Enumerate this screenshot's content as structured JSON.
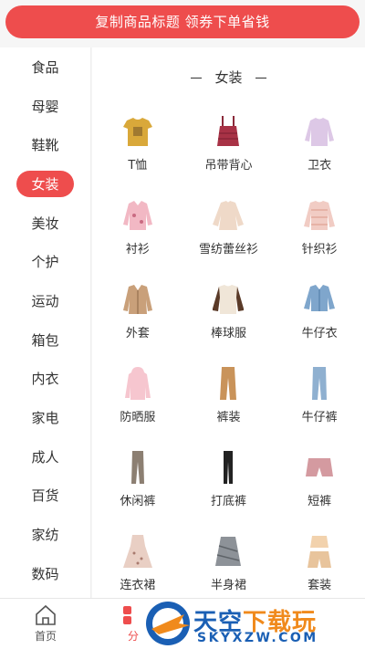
{
  "search": {
    "label": "复制商品标题 领券下单省钱"
  },
  "sidebar": {
    "items": [
      {
        "label": "食品"
      },
      {
        "label": "母婴"
      },
      {
        "label": "鞋靴"
      },
      {
        "label": "女装",
        "active": true
      },
      {
        "label": "美妆"
      },
      {
        "label": "个护"
      },
      {
        "label": "运动"
      },
      {
        "label": "箱包"
      },
      {
        "label": "内衣"
      },
      {
        "label": "家电"
      },
      {
        "label": "成人"
      },
      {
        "label": "百货"
      },
      {
        "label": "家纺"
      },
      {
        "label": "数码"
      }
    ]
  },
  "section": {
    "title": "女装"
  },
  "grid": {
    "items": [
      {
        "label": "T恤",
        "icon": "tshirt-icon"
      },
      {
        "label": "吊带背心",
        "icon": "camisole-icon"
      },
      {
        "label": "卫衣",
        "icon": "sweatshirt-icon"
      },
      {
        "label": "衬衫",
        "icon": "shirt-icon"
      },
      {
        "label": "雪纺蕾丝衫",
        "icon": "chiffon-blouse-icon"
      },
      {
        "label": "针织衫",
        "icon": "knit-sweater-icon"
      },
      {
        "label": "外套",
        "icon": "coat-icon"
      },
      {
        "label": "棒球服",
        "icon": "baseball-jacket-icon"
      },
      {
        "label": "牛仔衣",
        "icon": "denim-jacket-icon"
      },
      {
        "label": "防晒服",
        "icon": "sun-protection-jacket-icon"
      },
      {
        "label": "裤装",
        "icon": "trousers-icon"
      },
      {
        "label": "牛仔裤",
        "icon": "jeans-icon"
      },
      {
        "label": "休闲裤",
        "icon": "casual-pants-icon"
      },
      {
        "label": "打底裤",
        "icon": "leggings-icon"
      },
      {
        "label": "短裤",
        "icon": "shorts-icon"
      },
      {
        "label": "连衣裙",
        "icon": "dress-icon"
      },
      {
        "label": "半身裙",
        "icon": "skirt-icon"
      },
      {
        "label": "套装",
        "icon": "outfit-set-icon"
      }
    ]
  },
  "tabbar": {
    "home_label": "首页",
    "category_label": "分"
  },
  "watermark": {
    "line1a": "天空",
    "line1b": "下载玩",
    "line2": "SKYXZW.COM"
  },
  "colors": {
    "accent": "#ee4d4d",
    "watermark_blue": "#1a5fb4",
    "watermark_orange": "#f08a1c"
  }
}
